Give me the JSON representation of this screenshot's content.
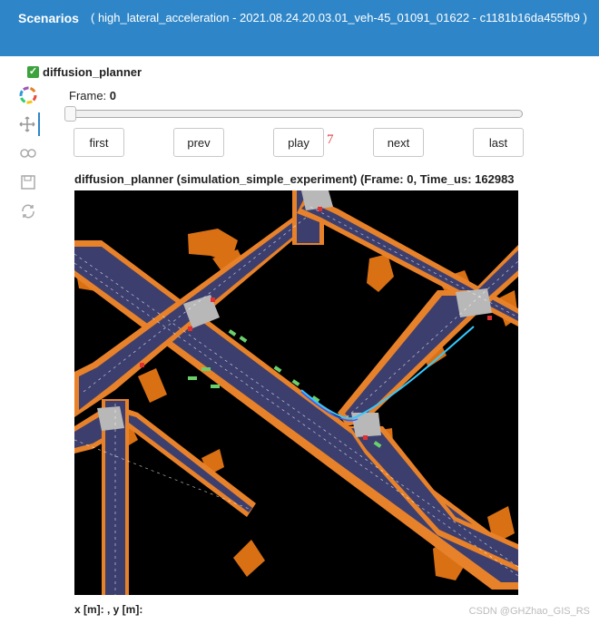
{
  "header": {
    "title": "Scenarios",
    "subtitle": "( high_lateral_acceleration - 2021.08.24.20.03.01_veh-45_01091_01622 - c1181b16da455fb9 )"
  },
  "planner": {
    "checked": true,
    "label": "diffusion_planner"
  },
  "toolbar": {
    "tools": [
      "logo-icon",
      "pan-icon",
      "zoom-icon",
      "save-icon",
      "reset-icon"
    ]
  },
  "frame": {
    "label": "Frame:",
    "value": "0",
    "slider_fraction": 0
  },
  "controls": {
    "first": "first",
    "prev": "prev",
    "play": "play",
    "next": "next",
    "last": "last"
  },
  "annotation": "7",
  "plot": {
    "title": "diffusion_planner (simulation_simple_experiment) (Frame: 0, Time_us: 162983"
  },
  "coords": "x [m]: , y [m]:",
  "watermark": "CSDN @GHZhao_GIS_RS",
  "colors": {
    "header": "#2e86c9",
    "background": "#000000",
    "lane_road": "#3c3f6e",
    "lane_edge": "#e8822a",
    "building": "#d97014",
    "intersection": "#b8b8b8",
    "vehicle": "#6bd06b",
    "ego_path": "#35c8ff"
  }
}
